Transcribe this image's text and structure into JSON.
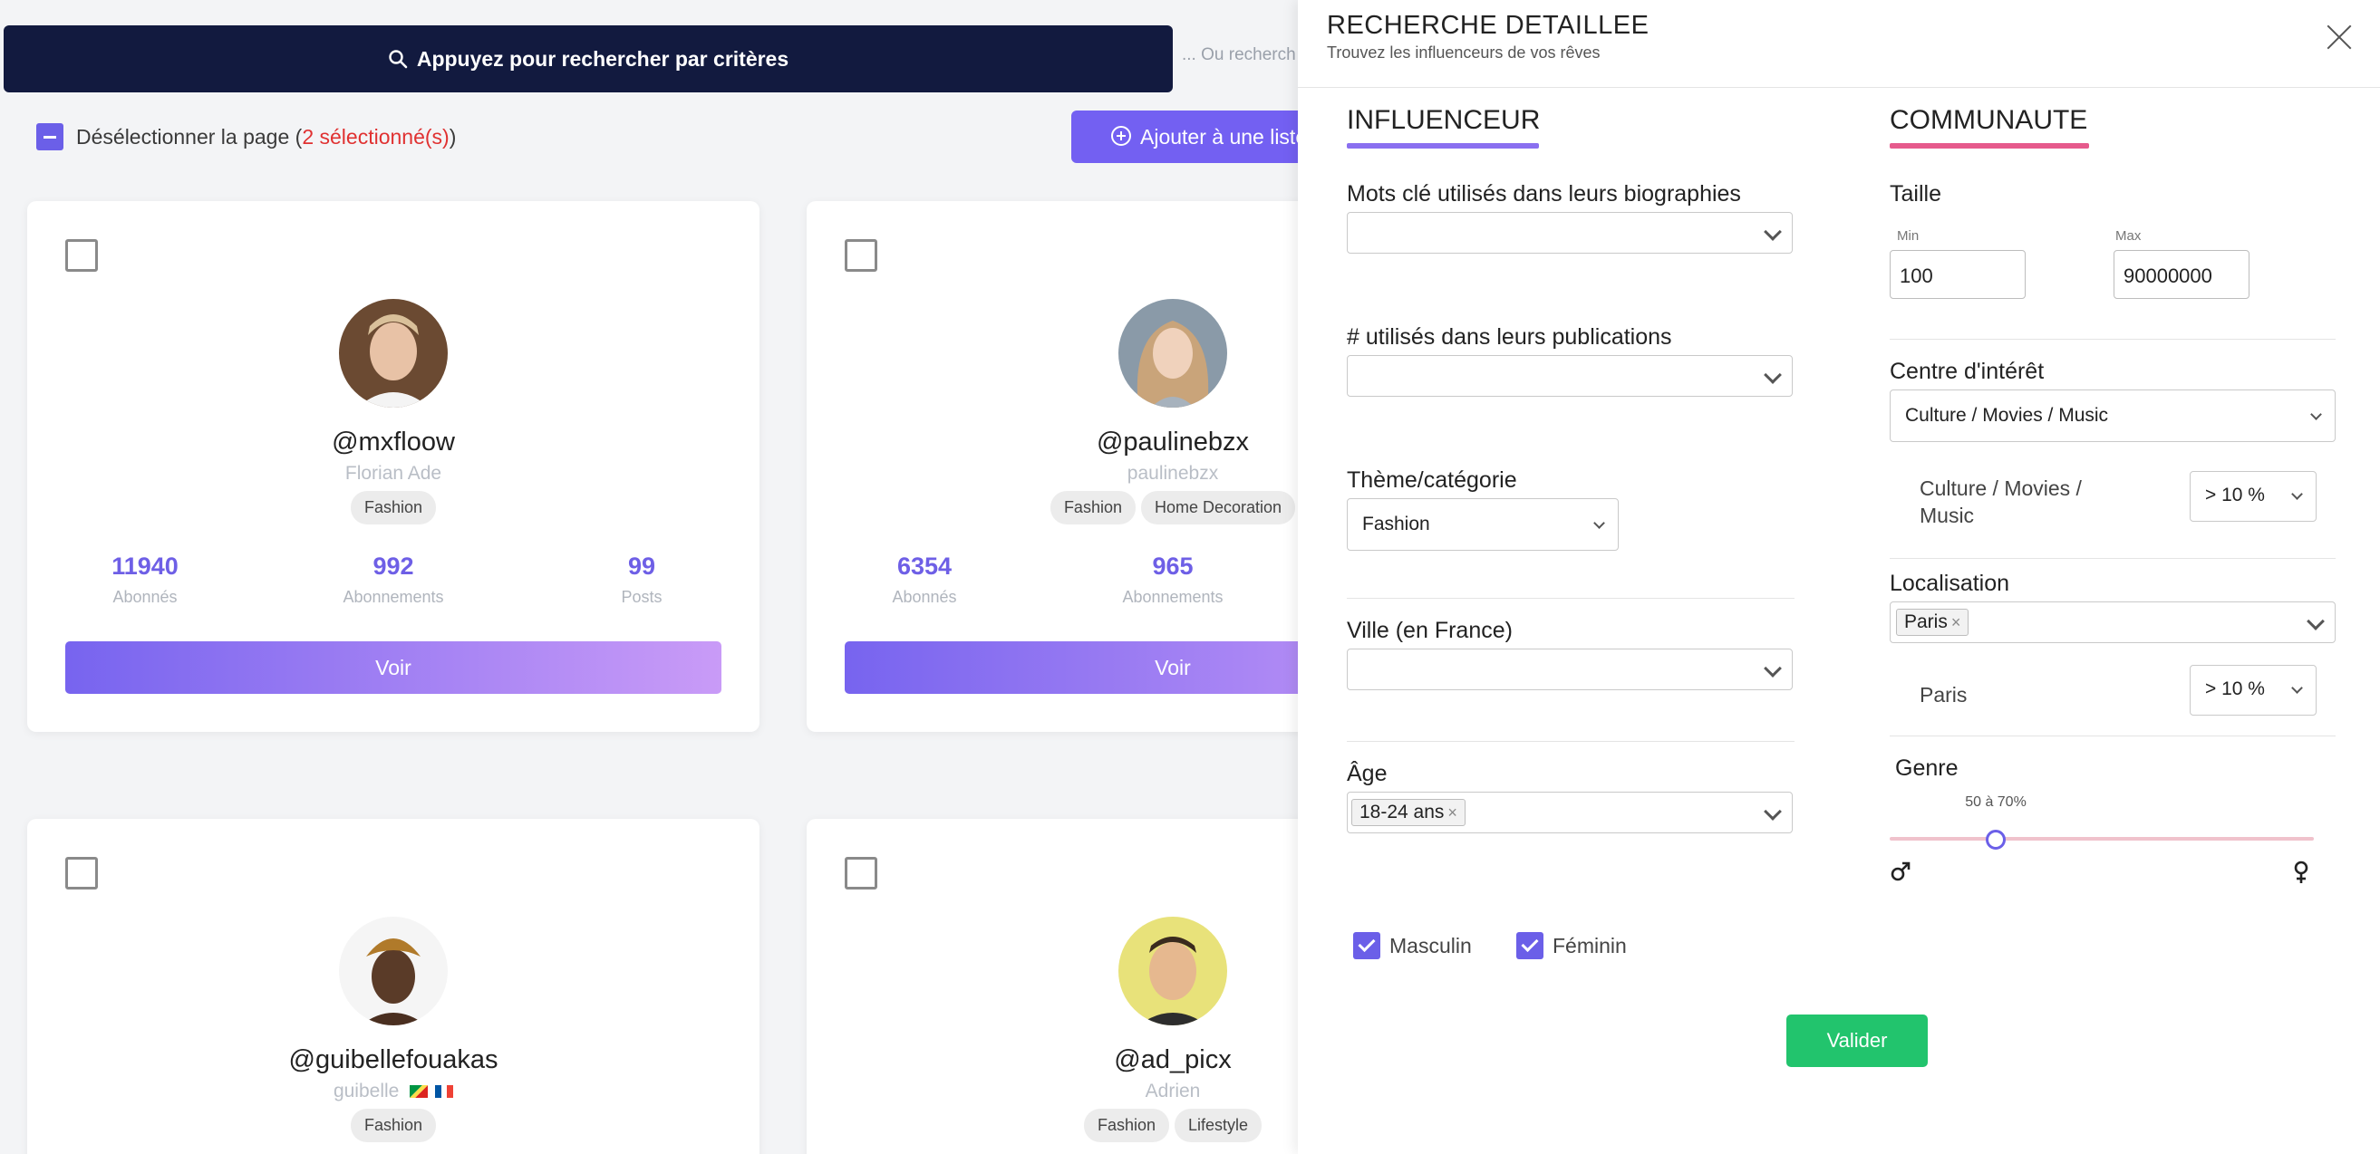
{
  "search": {
    "button_label": "Appuyez pour rechercher par critères",
    "alt_text": "... Ou recherch"
  },
  "selection": {
    "deselect_label": "Désélectionner la page (",
    "selected_count": "2 sélectionné(s)",
    "close_paren": ")"
  },
  "add_list_label": "Ajouter à une liste",
  "cards": [
    {
      "handle": "@mxfloow",
      "name": "Florian Ade",
      "tags": [
        "Fashion"
      ],
      "followers": "11940",
      "following": "992",
      "posts": "99"
    },
    {
      "handle": "@paulinebzx",
      "name": "paulinebzx",
      "tags": [
        "Fashion",
        "Home Decoration"
      ],
      "followers": "6354",
      "following": "965",
      "posts": ""
    },
    {
      "handle": "@guibellefouakas",
      "name": "guibelle",
      "tags": [
        "Fashion"
      ]
    },
    {
      "handle": "@ad_picx",
      "name": "Adrien",
      "tags": [
        "Fashion",
        "Lifestyle"
      ]
    }
  ],
  "card_labels": {
    "followers": "Abonnés",
    "following": "Abonnements",
    "posts": "Posts",
    "view": "Voir"
  },
  "panel": {
    "title": "RECHERCHE DETAILLEE",
    "subtitle": "Trouvez les influenceurs de vos rêves",
    "influencer": {
      "heading": "INFLUENCEUR",
      "bio_keywords_label": "Mots clé utilisés dans leurs biographies",
      "hashtags_label": "# utilisés dans leurs publications",
      "theme_label": "Thème/catégorie",
      "theme_value": "Fashion",
      "city_label": "Ville (en France)",
      "age_label": "Âge",
      "age_chip": "18-24 ans",
      "male_label": "Masculin",
      "female_label": "Féminin"
    },
    "community": {
      "heading": "COMMUNAUTE",
      "size_label": "Taille",
      "min_label": "Min",
      "max_label": "Max",
      "min_value": "100",
      "max_value": "90000000",
      "interest_label": "Centre d'intérêt",
      "interest_value": "Culture / Movies / Music",
      "interest_sub_label": "Culture / Movies / Music",
      "interest_pct": "> 10 %",
      "location_label": "Localisation",
      "location_chip": "Paris",
      "location_sub_label": "Paris",
      "location_pct": "> 10 %",
      "gender_label": "Genre",
      "gender_range": "50 à 70%",
      "gender_slider_position": 0.25
    },
    "submit_label": "Valider"
  },
  "colors": {
    "accent": "#6b5fe8",
    "navy": "#121a3f",
    "influencer_underline": "#8a6ff0",
    "community_underline": "#e65a8c",
    "submit": "#22c46d",
    "selected_red": "#e03131"
  }
}
